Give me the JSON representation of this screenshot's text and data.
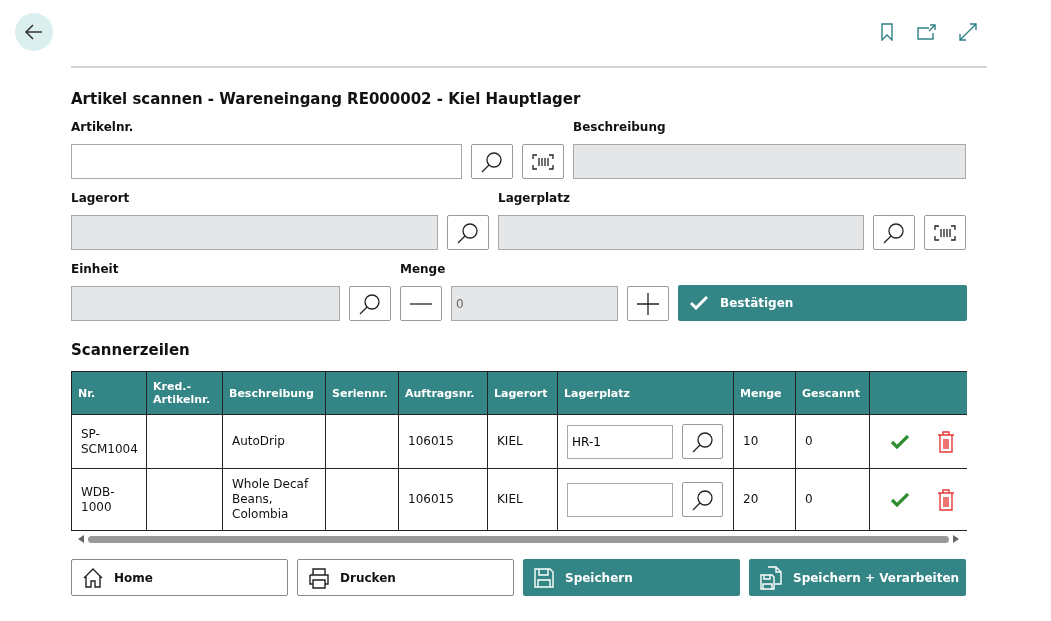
{
  "title": "Artikel scannen - Wareneingang RE000002 - Kiel Hauptlager",
  "fields": {
    "artikelnr": {
      "label": "Artikelnr.",
      "disabled": false
    },
    "beschreibung": {
      "label": "Beschreibung",
      "disabled": true
    },
    "lagerort": {
      "label": "Lagerort",
      "disabled": true
    },
    "lagerplatz": {
      "label": "Lagerplatz",
      "disabled": true
    },
    "einheit": {
      "label": "Einheit",
      "disabled": true
    },
    "menge": {
      "label": "Menge",
      "value": "0",
      "disabled": true
    }
  },
  "confirm_button": "Bestätigen",
  "table": {
    "title": "Scannerzeilen",
    "columns": [
      "Nr.",
      "Kred.-Artikelnr.",
      "Beschreibung",
      "Seriennr.",
      "Auftragsnr.",
      "Lagerort",
      "Lagerplatz",
      "Menge",
      "Gescannt"
    ],
    "rows": [
      {
        "nr": "SP-SCM1004",
        "beschreibung": "AutoDrip",
        "auftragsnr": "106015",
        "lagerort": "KIEL",
        "lagerplatz": "HR-1",
        "menge": "10",
        "gescannt": "0"
      },
      {
        "nr": "WDB-1000",
        "beschreibung": "Whole Decaf Beans, Colombia",
        "auftragsnr": "106015",
        "lagerort": "KIEL",
        "menge": "20",
        "gescannt": "0"
      }
    ]
  },
  "buttons": [
    {
      "label": "Home",
      "kind": "secondary"
    },
    {
      "label": "Drucken",
      "kind": "secondary"
    },
    {
      "label": "Speichern",
      "kind": "primary"
    },
    {
      "label": "Speichern + Verarbeiten",
      "kind": "primary"
    }
  ]
}
